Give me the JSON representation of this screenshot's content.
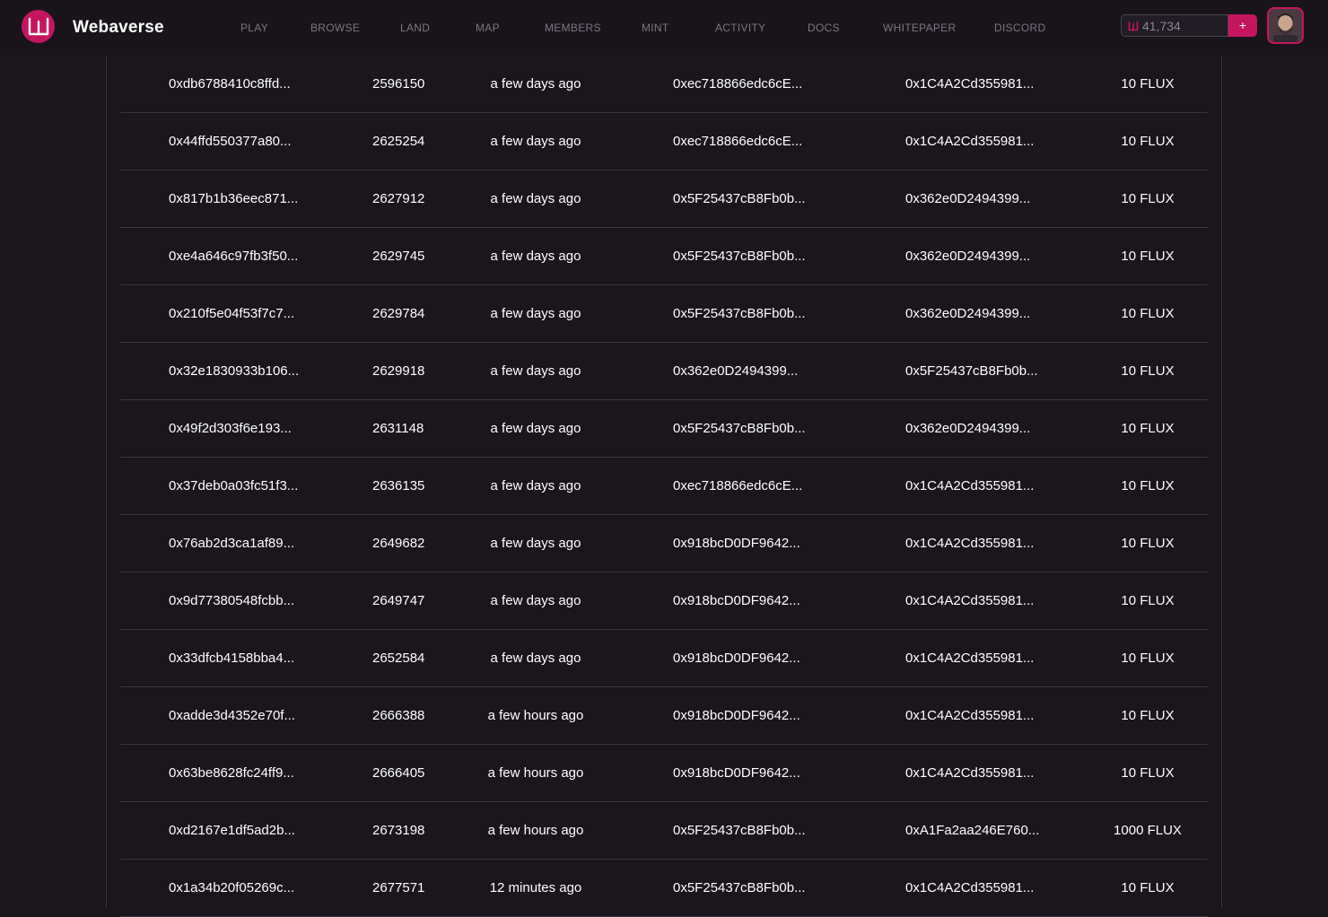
{
  "app": {
    "title": "Webaverse",
    "accent_color": "#c4165f",
    "logo_icon": "webaverse-logo-icon"
  },
  "nav": {
    "items": [
      {
        "label": "PLAY"
      },
      {
        "label": "BROWSE"
      },
      {
        "label": "LAND"
      },
      {
        "label": "MAP"
      },
      {
        "label": "MEMBERS"
      },
      {
        "label": "MINT"
      },
      {
        "label": "ACTIVITY"
      },
      {
        "label": "DOCS"
      },
      {
        "label": "WHITEPAPER"
      },
      {
        "label": "DISCORD"
      }
    ]
  },
  "wallet": {
    "balance": "41,734",
    "balance_icon": "flux-icon",
    "add_label": "+"
  },
  "transactions": [
    {
      "hash": "0xdb6788410c8ffd...",
      "block": "2596150",
      "time": "a few days ago",
      "from": "0xec718866edc6cE...",
      "to": "0x1C4A2Cd355981...",
      "amount": "10 FLUX"
    },
    {
      "hash": "0x44ffd550377a80...",
      "block": "2625254",
      "time": "a few days ago",
      "from": "0xec718866edc6cE...",
      "to": "0x1C4A2Cd355981...",
      "amount": "10 FLUX"
    },
    {
      "hash": "0x817b1b36eec871...",
      "block": "2627912",
      "time": "a few days ago",
      "from": "0x5F25437cB8Fb0b...",
      "to": "0x362e0D2494399...",
      "amount": "10 FLUX"
    },
    {
      "hash": "0xe4a646c97fb3f50...",
      "block": "2629745",
      "time": "a few days ago",
      "from": "0x5F25437cB8Fb0b...",
      "to": "0x362e0D2494399...",
      "amount": "10 FLUX"
    },
    {
      "hash": "0x210f5e04f53f7c7...",
      "block": "2629784",
      "time": "a few days ago",
      "from": "0x5F25437cB8Fb0b...",
      "to": "0x362e0D2494399...",
      "amount": "10 FLUX"
    },
    {
      "hash": "0x32e1830933b106...",
      "block": "2629918",
      "time": "a few days ago",
      "from": "0x362e0D2494399...",
      "to": "0x5F25437cB8Fb0b...",
      "amount": "10 FLUX"
    },
    {
      "hash": "0x49f2d303f6e193...",
      "block": "2631148",
      "time": "a few days ago",
      "from": "0x5F25437cB8Fb0b...",
      "to": "0x362e0D2494399...",
      "amount": "10 FLUX"
    },
    {
      "hash": "0x37deb0a03fc51f3...",
      "block": "2636135",
      "time": "a few days ago",
      "from": "0xec718866edc6cE...",
      "to": "0x1C4A2Cd355981...",
      "amount": "10 FLUX"
    },
    {
      "hash": "0x76ab2d3ca1af89...",
      "block": "2649682",
      "time": "a few days ago",
      "from": "0x918bcD0DF9642...",
      "to": "0x1C4A2Cd355981...",
      "amount": "10 FLUX"
    },
    {
      "hash": "0x9d77380548fcbb...",
      "block": "2649747",
      "time": "a few days ago",
      "from": "0x918bcD0DF9642...",
      "to": "0x1C4A2Cd355981...",
      "amount": "10 FLUX"
    },
    {
      "hash": "0x33dfcb4158bba4...",
      "block": "2652584",
      "time": "a few days ago",
      "from": "0x918bcD0DF9642...",
      "to": "0x1C4A2Cd355981...",
      "amount": "10 FLUX"
    },
    {
      "hash": "0xadde3d4352e70f...",
      "block": "2666388",
      "time": "a few hours ago",
      "from": "0x918bcD0DF9642...",
      "to": "0x1C4A2Cd355981...",
      "amount": "10 FLUX"
    },
    {
      "hash": "0x63be8628fc24ff9...",
      "block": "2666405",
      "time": "a few hours ago",
      "from": "0x918bcD0DF9642...",
      "to": "0x1C4A2Cd355981...",
      "amount": "10 FLUX"
    },
    {
      "hash": "0xd2167e1df5ad2b...",
      "block": "2673198",
      "time": "a few hours ago",
      "from": "0x5F25437cB8Fb0b...",
      "to": "0xA1Fa2aa246E760...",
      "amount": "1000 FLUX"
    },
    {
      "hash": "0x1a34b20f05269c...",
      "block": "2677571",
      "time": "12 minutes ago",
      "from": "0x5F25437cB8Fb0b...",
      "to": "0x1C4A2Cd355981...",
      "amount": "10 FLUX"
    }
  ]
}
